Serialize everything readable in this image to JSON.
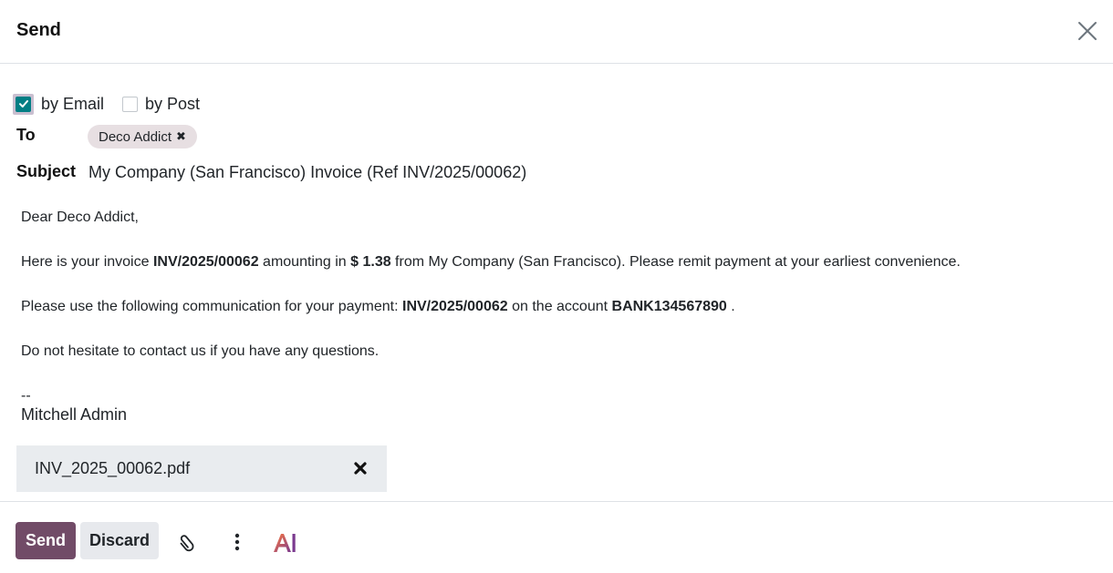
{
  "dialog": {
    "title": "Send"
  },
  "options": [
    {
      "label": "by Email",
      "checked": true
    },
    {
      "label": "by Post",
      "checked": false
    }
  ],
  "recipients": {
    "label": "To",
    "tags": [
      {
        "name": "Deco Addict"
      }
    ]
  },
  "subject": {
    "label": "Subject",
    "value": "My Company (San Francisco) Invoice (Ref INV/2025/00062)"
  },
  "message": {
    "greeting": "Dear Deco Addict,",
    "p1": {
      "a": "Here is your invoice ",
      "invoice": "INV/2025/00062",
      "b": " amounting in ",
      "amount": "$ 1.38",
      "c": " from My Company (San Francisco). Please remit payment at your earliest convenience."
    },
    "p2": {
      "a": "Please use the following communication for your payment: ",
      "reference": "INV/2025/00062",
      "b": " on the account ",
      "account": "BANK134567890",
      "c": " ."
    },
    "p3": "Do not hesitate to contact us if you have any questions.",
    "sig_sep": "--",
    "sig_name": "Mitchell Admin"
  },
  "attachment": {
    "filename": "INV_2025_00062.pdf"
  },
  "footer": {
    "send_label": "Send",
    "discard_label": "Discard",
    "ai_label": "AI"
  },
  "colors": {
    "primary": "#714b67",
    "checkbox": "#017e84",
    "tag_bg": "#e7dfe2",
    "secondary_btn": "#e7e9ed"
  }
}
